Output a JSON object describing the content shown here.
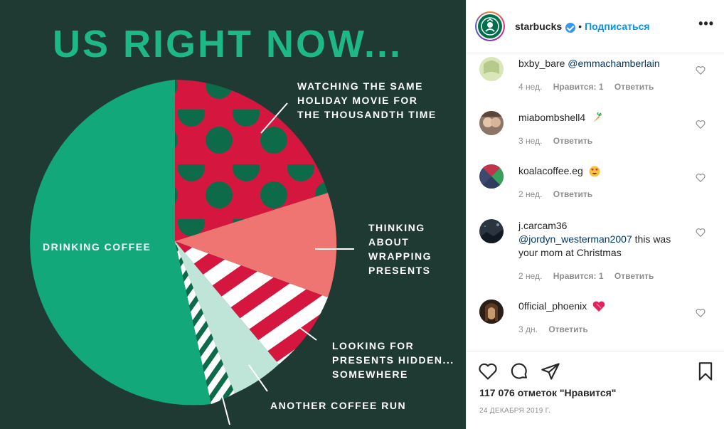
{
  "post_image": {
    "title": "US RIGHT NOW...",
    "labels": {
      "drinking": "DRINKING COFFEE",
      "movie": [
        "WATCHING THE SAME",
        "HOLIDAY MOVIE FOR",
        "THE THOUSANDTH TIME"
      ],
      "wrapping": [
        "THINKING",
        "ABOUT",
        "WRAPPING",
        "PRESENTS"
      ],
      "hidden": [
        "LOOKING FOR",
        "PRESENTS HIDDEN...",
        "SOMEWHERE"
      ],
      "coffee_run": "ANOTHER COFFEE RUN"
    },
    "colors": {
      "background": "#1f3a33",
      "green": "#13a879",
      "red": "#d5173f",
      "salmon": "#ef7572",
      "mint": "#bfe5d9",
      "title": "#1eb886"
    }
  },
  "header": {
    "username": "starbucks",
    "separator": "•",
    "follow_label": "Подписаться",
    "more_label": "•••"
  },
  "comments": [
    {
      "user": "bxby_bare",
      "text": "",
      "mention": "@emmachamberlain",
      "after": "",
      "time": "4 нед.",
      "likes": "Нравится: 1",
      "reply": "Ответить",
      "avatar_color": "#d9e6b8"
    },
    {
      "user": "miabombshell4",
      "text": "",
      "mention": "",
      "after": "",
      "time": "3 нед.",
      "likes": "",
      "reply": "Ответить",
      "avatar_color": "#8a7566"
    },
    {
      "user": "koalacoffee.eg",
      "text": "",
      "mention": "",
      "after": "",
      "time": "2 нед.",
      "likes": "",
      "reply": "Ответить",
      "avatar_color": "#3e4a6d"
    },
    {
      "user": "j.carcam36",
      "text": "",
      "mention": "@jordyn_westerman2007",
      "after": " this was your mom at Christmas",
      "time": "2 нед.",
      "likes": "Нравится: 1",
      "reply": "Ответить",
      "avatar_color": "#2b3540"
    },
    {
      "user": "0fficial_phoenix",
      "text": "",
      "mention": "",
      "after": "",
      "time": "3 дн.",
      "likes": "",
      "reply": "Ответить",
      "avatar_color": "#4d3a2c"
    }
  ],
  "footer": {
    "likes": "117 076 отметок \"Нравится\"",
    "date": "24 ДЕКАБРЯ 2019 Г."
  }
}
